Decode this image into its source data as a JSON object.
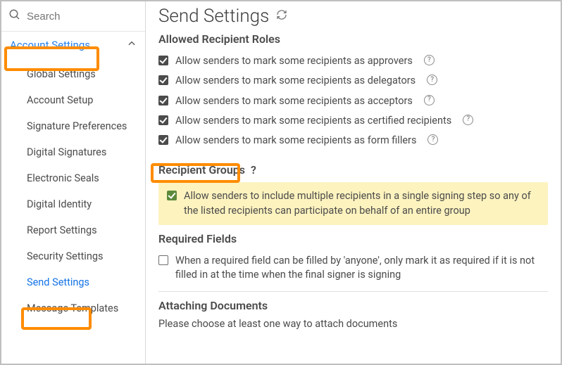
{
  "search": {
    "placeholder": "Search"
  },
  "sidebar": {
    "header": "Account Settings",
    "items": [
      {
        "label": "Global Settings"
      },
      {
        "label": "Account Setup"
      },
      {
        "label": "Signature Preferences"
      },
      {
        "label": "Digital Signatures"
      },
      {
        "label": "Electronic Seals"
      },
      {
        "label": "Digital Identity"
      },
      {
        "label": "Report Settings"
      },
      {
        "label": "Security Settings"
      },
      {
        "label": "Send Settings",
        "selected": true
      },
      {
        "label": "Message Templates"
      }
    ]
  },
  "page": {
    "title": "Send Settings"
  },
  "sections": {
    "allowed_roles": {
      "title": "Allowed Recipient Roles",
      "options": [
        {
          "label": "Allow senders to mark some recipients as approvers",
          "checked": true,
          "help": true
        },
        {
          "label": "Allow senders to mark some recipients as delegators",
          "checked": true,
          "help": true
        },
        {
          "label": "Allow senders to mark some recipients as acceptors",
          "checked": true,
          "help": true
        },
        {
          "label": "Allow senders to mark some recipients as certified recipients",
          "checked": true,
          "help": true
        },
        {
          "label": "Allow senders to mark some recipients as form fillers",
          "checked": true,
          "help": true
        }
      ]
    },
    "recipient_groups": {
      "title": "Recipient Groups",
      "help": true,
      "option": {
        "label": "Allow senders to include multiple recipients in a single signing step so any of the listed recipients can participate on behalf of an entire group",
        "checked": true
      }
    },
    "required_fields": {
      "title": "Required Fields",
      "option": {
        "label": "When a required field can be filled by 'anyone', only mark it as required if it is not filled in at the time when the final signer is signing",
        "checked": false
      }
    },
    "attaching_documents": {
      "title": "Attaching Documents",
      "note": "Please choose at least one way to attach documents"
    }
  }
}
